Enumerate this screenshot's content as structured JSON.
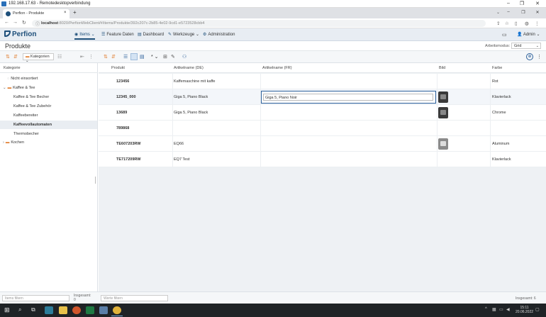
{
  "remote": {
    "title": "192.168.17.63 - Remotedesktopverbindung",
    "min": "–",
    "max": "❐",
    "close": "✕"
  },
  "browser": {
    "tab_title": "Perfion - Produkte",
    "tab_close": "×",
    "new_tab": "+",
    "url_host": "localhost",
    "url_path": ":8020/PerfionWebClient/#/items/Produkte/392c207c-2b85-4e02-9cd1-e5723528cbb4"
  },
  "app": {
    "logo": "Perfion",
    "menu": [
      {
        "label": "Items",
        "icon": "◉",
        "chev": "⌄"
      },
      {
        "label": "Feature Daten",
        "icon": "☰"
      },
      {
        "label": "Dashboard",
        "icon": "▤"
      },
      {
        "label": "Werkzeuge",
        "icon": "✎",
        "chev": "⌄"
      },
      {
        "label": "Administration",
        "icon": "⚙"
      }
    ],
    "user": "Admin",
    "user_chev": "⌄"
  },
  "page": {
    "title": "Produkte",
    "workmode_label": "Arbeitsmodus:",
    "workmode_value": "Grid",
    "kategorien_btn": "Kategorien",
    "sort_label": "*"
  },
  "tree": {
    "header": "Kategorie",
    "items": [
      {
        "label": "Nicht einsortiert"
      },
      {
        "label": "Kaffee & Tee",
        "arrow": "⌄"
      },
      {
        "label": "Kaffee & Tee Becher"
      },
      {
        "label": "Kaffee & Tee Zubehör"
      },
      {
        "label": "Kaffeebereiter"
      },
      {
        "label": "Kaffeevollautomaten"
      },
      {
        "label": "Thermobecher"
      },
      {
        "label": "Kochen",
        "arrow": "›"
      }
    ]
  },
  "grid": {
    "columns": [
      "Produkt",
      "Artikelname (DE)",
      "Artikelname (FR)",
      "Bild",
      "Farbe"
    ],
    "rows": [
      {
        "produkt": "123456",
        "name_de": "Kaffemaschine mit kaffe",
        "name_fr": "",
        "farbe": "Rot"
      },
      {
        "produkt": "12345_000",
        "name_de": "Giga 5, Piano Black",
        "name_fr": "Giga 5, Piano Noir",
        "farbe": "Klavierlack"
      },
      {
        "produkt": "13689",
        "name_de": "Giga 5, Piano Black",
        "name_fr": "",
        "farbe": "Chrome"
      },
      {
        "produkt": "789868",
        "name_de": "",
        "name_fr": "",
        "farbe": ""
      },
      {
        "produkt": "TE607203RW",
        "name_de": "EQ66",
        "name_fr": "",
        "farbe": "Aluminum"
      },
      {
        "produkt": "TE717209RW",
        "name_de": "EQ7 Test",
        "name_fr": "",
        "farbe": "Klavierlack"
      }
    ]
  },
  "footer": {
    "items_filter_placeholder": "Items filtern",
    "left_count_label": "Insgesamt:",
    "left_count": "0",
    "werte_filter_placeholder": "Werte filtern",
    "right_count": "Insgesamt: 6"
  },
  "taskbar": {
    "time": "15:11",
    "date": "20.06.2022"
  }
}
